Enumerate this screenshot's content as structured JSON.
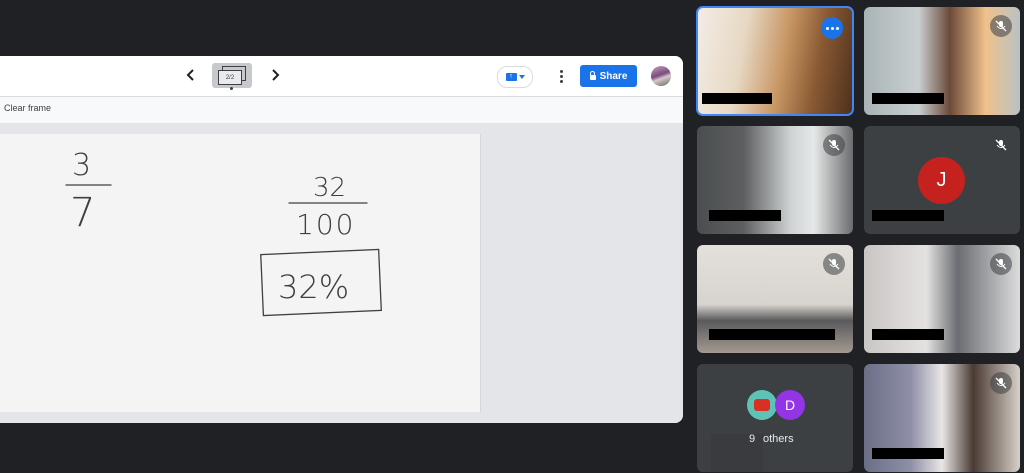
{
  "whiteboard": {
    "frame_indicator": "2/2",
    "share_label": "Share",
    "clear_frame_label": "Clear frame",
    "handwriting": {
      "fraction1_num": "3",
      "fraction1_den": "7",
      "fraction2_num": "32",
      "fraction2_den": "100",
      "boxed_answer": "32%"
    }
  },
  "participants": {
    "others": {
      "count": "9",
      "label": "others",
      "avatar_letter": "D"
    },
    "letter_tile": {
      "avatar_letter": "J"
    }
  },
  "colors": {
    "accent": "#1a73e8",
    "active_tile_border": "#4285f4",
    "avatar_j": "#c5221f",
    "avatar_d": "#9334e6",
    "background": "#202124"
  },
  "icons": {
    "prev": "chevron-left-icon",
    "next": "chevron-right-icon",
    "present": "present-screen-icon",
    "more": "more-vert-icon",
    "lock": "lock-icon",
    "mic_off": "mic-off-icon",
    "options": "more-horiz-icon"
  }
}
